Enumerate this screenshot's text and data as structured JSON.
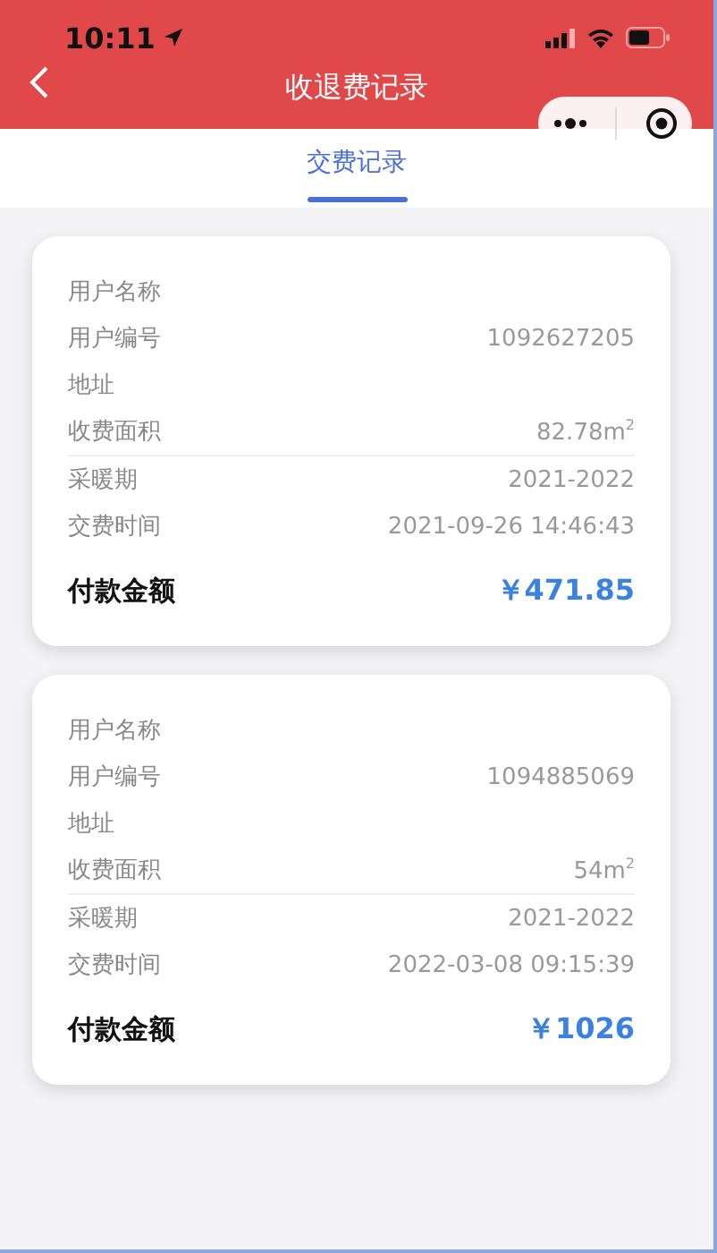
{
  "status_bar": {
    "time": "10:11"
  },
  "nav_bar": {
    "title": "收退费记录"
  },
  "tabs": [
    {
      "label": "交费记录",
      "selected": true
    }
  ],
  "records": [
    {
      "sections": [
        [
          {
            "label": "用户名称"
          },
          {
            "label": "用户编号",
            "value": "1092627205"
          },
          {
            "label": "地址"
          },
          {
            "label": "收费面积",
            "value": "82.78m$^{2}$"
          }
        ],
        [
          {
            "label": "采暖期",
            "value": "2021-2022"
          },
          {
            "label": "交费时间",
            "value": "2021-09-26 14:46:43"
          }
        ]
      ],
      "total": {
        "label": "付款金额",
        "amount": "￥471.85"
      }
    },
    {
      "sections": [
        [
          {
            "label": "用户名称"
          },
          {
            "label": "用户编号",
            "value": "1094885069"
          },
          {
            "label": "地址"
          },
          {
            "label": "收费面积",
            "value": "54m$^{2}$"
          }
        ],
        [
          {
            "label": "采暖期",
            "value": "2021-2022"
          },
          {
            "label": "交费时间",
            "value": "2022-03-08 09:15:39"
          }
        ]
      ],
      "total": {
        "label": "付款金额",
        "amount": "￥1026"
      }
    }
  ]
}
